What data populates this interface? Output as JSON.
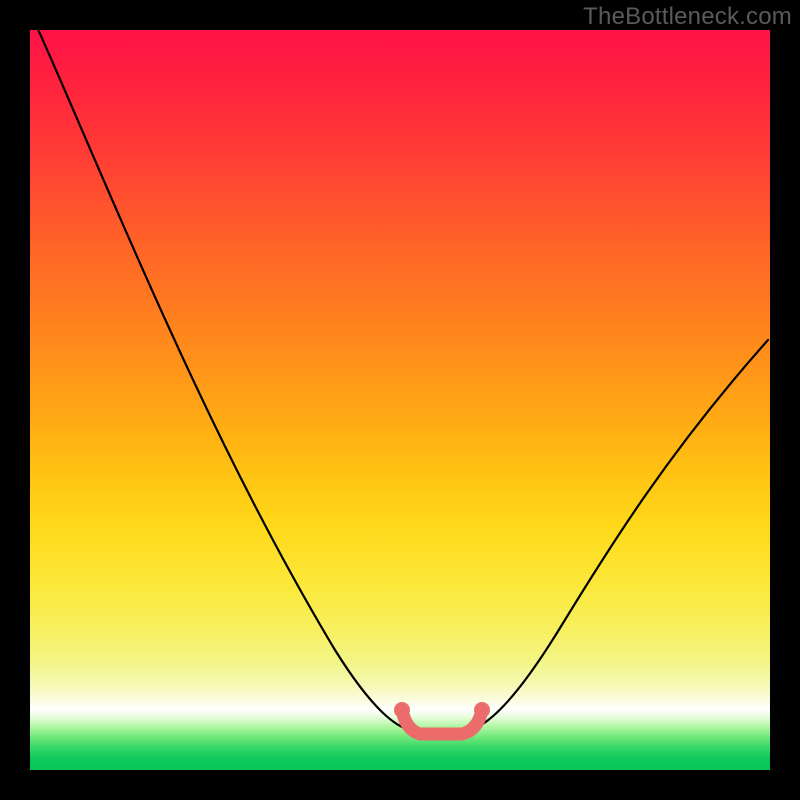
{
  "watermark": "TheBottleneck.com",
  "chart_data": {
    "type": "line",
    "title": "",
    "xlabel": "",
    "ylabel": "",
    "xlim": [
      0,
      100
    ],
    "ylim": [
      0,
      100
    ],
    "series": [
      {
        "name": "bottleneck-curve",
        "x": [
          0,
          6,
          12,
          18,
          24,
          30,
          36,
          42,
          48,
          51,
          55,
          59,
          63,
          70,
          78,
          86,
          94,
          100
        ],
        "values": [
          100,
          88,
          77,
          65,
          54,
          42,
          32,
          22,
          13,
          8,
          6,
          6,
          8,
          13,
          22,
          32,
          43,
          52
        ]
      },
      {
        "name": "bottleneck-optimal-segment",
        "color": "#ec6b6b",
        "x": [
          50,
          52,
          55,
          58,
          60.5
        ],
        "values": [
          8.5,
          7,
          6,
          7,
          8.5
        ]
      }
    ],
    "gradient_bands": [
      {
        "pos": 0,
        "color": "#ff1246"
      },
      {
        "pos": 45,
        "color": "#ff921a"
      },
      {
        "pos": 75,
        "color": "#fbe83a"
      },
      {
        "pos": 91.8,
        "color": "#ffffff"
      },
      {
        "pos": 100,
        "color": "#06c657"
      }
    ]
  }
}
